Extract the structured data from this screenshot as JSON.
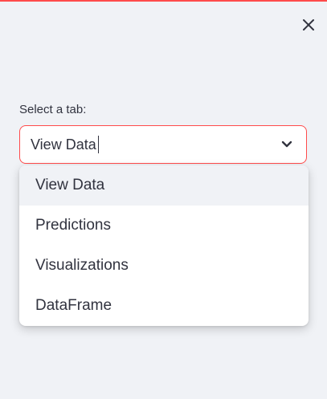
{
  "header": {
    "accent_color": "#ff4b4b",
    "close_icon": "close-icon"
  },
  "select": {
    "label": "Select a tab:",
    "value": "View Data",
    "border_color": "#ff4b4b",
    "chevron_icon": "chevron-down-icon"
  },
  "dropdown": {
    "options": [
      {
        "label": "View Data",
        "highlighted": true
      },
      {
        "label": "Predictions",
        "highlighted": false
      },
      {
        "label": "Visualizations",
        "highlighted": false
      },
      {
        "label": "DataFrame",
        "highlighted": false
      }
    ]
  }
}
